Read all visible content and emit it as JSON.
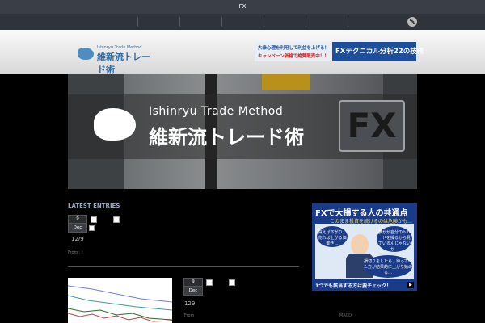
{
  "topbar": {
    "title": "FX"
  },
  "header": {
    "logo_sub": "Ishinryu Trade Method",
    "logo_main": "維新流トレード術",
    "banner_line1": "大衆心理を利用して利益を上げる！",
    "banner_line2": "キャンペーン価格で絶賛販売中！！",
    "banner_right": "FXテクニカル分析22の技術"
  },
  "hero": {
    "title_en": "Ishinryu Trade Method",
    "title_ja": "維新流トレード術",
    "badge": "FX"
  },
  "latest": {
    "heading": "LATEST ENTRIES",
    "entries": [
      {
        "day": "9",
        "month": "Dec",
        "title": "12/9",
        "meta": "From : i"
      },
      {
        "day": "9",
        "month": "Dec",
        "title": "129",
        "meta": "From"
      }
    ]
  },
  "sidebar_ad": {
    "headline": "FXで大損する人の共通点",
    "subline": "このまま投資を続けるのは危険かも…",
    "bubble1": "買えば下がり、売れば上がる価動き…",
    "bubble2": "誰かが自分のトレードを操るから見ているんじゃないか…",
    "bubble3": "損切りをしたら、待っていた方が結果的に上がり始める…",
    "footer": "1つでも該当する方は要チェック！",
    "play": "▶"
  },
  "sidebar_tab": {
    "label": "MACD"
  },
  "colors": {
    "accent": "#1a3a8a",
    "topbar": "#3a3f47",
    "nav": "#2f333a"
  }
}
